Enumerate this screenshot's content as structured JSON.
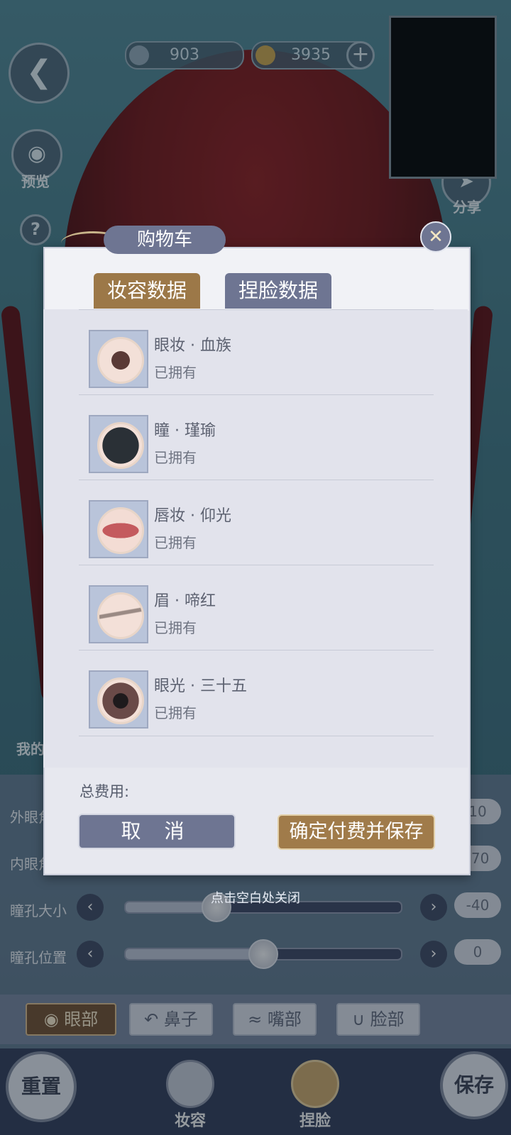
{
  "currency": {
    "jade": "903",
    "coins": "3935"
  },
  "side_buttons": {
    "preview_label": "预览",
    "share_label": "分享",
    "help_label": "?",
    "mine_label": "我的"
  },
  "modal": {
    "title": "购物车",
    "tabs": [
      {
        "label": "妆容数据",
        "active": true
      },
      {
        "label": "捏脸数据",
        "active": false
      }
    ],
    "items": [
      {
        "name": "眼妆 · 血族",
        "status": "已拥有"
      },
      {
        "name": "瞳 · 瑾瑜",
        "status": "已拥有"
      },
      {
        "name": "唇妆 · 仰光",
        "status": "已拥有"
      },
      {
        "name": "眉 · 啼红",
        "status": "已拥有"
      },
      {
        "name": "眼光 · 三十五",
        "status": "已拥有"
      }
    ],
    "total_label": "总费用:",
    "cancel_label": "取 消",
    "confirm_label": "确定付费并保存",
    "close_hint": "点击空白处关闭"
  },
  "sliders": [
    {
      "label": "外眼角",
      "value": "10",
      "fraction": 0.55
    },
    {
      "label": "内眼角高",
      "value": "-70",
      "fraction": 0.1
    },
    {
      "label": "瞳孔大小",
      "value": "-40",
      "fraction": 0.33
    },
    {
      "label": "瞳孔位置",
      "value": "0",
      "fraction": 0.5
    }
  ],
  "face_tabs": [
    {
      "label": "眼部",
      "active": true
    },
    {
      "label": "鼻子",
      "active": false
    },
    {
      "label": "嘴部",
      "active": false
    },
    {
      "label": "脸部",
      "active": false
    }
  ],
  "bottom_nav": {
    "reset_label": "重置",
    "makeup_label": "妆容",
    "face_label": "捏脸",
    "save_label": "保存"
  }
}
